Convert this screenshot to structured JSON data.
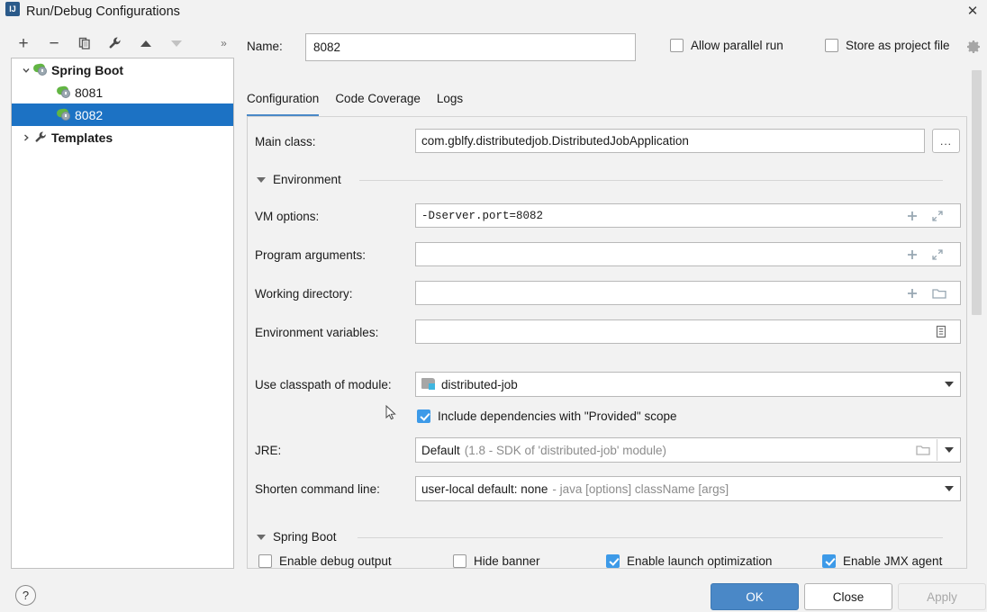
{
  "window": {
    "title": "Run/Debug Configurations",
    "app_icon": "intellij-idea-icon",
    "close_icon": "✕"
  },
  "toolbar": {
    "add_label": "+",
    "remove_label": "−",
    "copy_label": "copy-configuration",
    "wrench_label": "edit-templates",
    "move_up_label": "move-up",
    "move_down_label": "move-down",
    "more_label": "»"
  },
  "tree": {
    "items": [
      {
        "label": "Spring Boot",
        "arrow": "⌄",
        "icon": "spring-boot-icon",
        "indent": 0,
        "bold": true,
        "selected": false,
        "expanded": true
      },
      {
        "label": "8081",
        "arrow": "",
        "icon": "spring-boot-icon",
        "indent": 1,
        "bold": false,
        "selected": false
      },
      {
        "label": "8082",
        "arrow": "",
        "icon": "spring-boot-icon",
        "indent": 1,
        "bold": false,
        "selected": true
      },
      {
        "label": "Templates",
        "arrow": "›",
        "icon": "wrench-icon",
        "indent": 0,
        "bold": true,
        "selected": false,
        "expanded": false
      }
    ]
  },
  "header": {
    "name_label": "Name:",
    "name_value": "8082",
    "name_placeholder": "",
    "allow_parallel_run": {
      "label": "Allow parallel run",
      "checked": false
    },
    "store_as_project_file": {
      "label": "Store as project file",
      "checked": false
    },
    "gear_icon": "gear-icon"
  },
  "tabs": [
    {
      "label": "Configuration",
      "active": true
    },
    {
      "label": "Code Coverage",
      "active": false
    },
    {
      "label": "Logs",
      "active": false
    }
  ],
  "form": {
    "main_class": {
      "label": "Main class:",
      "value": "com.gblfy.distributedjob.DistributedJobApplication",
      "browse_label": "..."
    },
    "environment_section": {
      "title": "Environment",
      "expanded": true
    },
    "vm_options": {
      "label": "VM options:",
      "value": "-Dserver.port=8082",
      "add_icon": "plus-icon",
      "expand_icon": "expand-icon"
    },
    "program_arguments": {
      "label": "Program arguments:",
      "value": "",
      "add_icon": "plus-icon",
      "expand_icon": "expand-icon"
    },
    "working_directory": {
      "label": "Working directory:",
      "value": "",
      "add_icon": "plus-icon",
      "browse_icon": "folder-icon"
    },
    "environment_variables": {
      "label": "Environment variables:",
      "value": "",
      "browse_icon": "list-icon"
    },
    "use_classpath_of_module": {
      "label": "Use classpath of module:",
      "value": "distributed-job",
      "icon": "module-icon"
    },
    "include_provided_scope": {
      "label": "Include dependencies with \"Provided\" scope",
      "checked": true
    },
    "jre": {
      "label": "JRE:",
      "value": "Default",
      "hint": "(1.8 - SDK of 'distributed-job' module)",
      "browse_icon": "folder-icon"
    },
    "shorten_command_line": {
      "label": "Shorten command line:",
      "value": "user-local default: none",
      "hint": "- java [options] className [args]"
    },
    "spring_boot_section": {
      "title": "Spring Boot",
      "expanded": true
    },
    "spring_boot_options": [
      {
        "label": "Enable debug output",
        "checked": false
      },
      {
        "label": "Hide banner",
        "checked": false
      },
      {
        "label": "Enable launch optimization",
        "checked": true
      },
      {
        "label": "Enable JMX agent",
        "checked": true
      }
    ]
  },
  "footer": {
    "help_label": "?",
    "ok_label": "OK",
    "close_label": "Close",
    "apply_label": "Apply"
  },
  "colors": {
    "selection_blue": "#1c72c4",
    "primary_button": "#4a88c7",
    "checkbox_blue": "#3d9ae8",
    "spring_green": "#62b543"
  }
}
